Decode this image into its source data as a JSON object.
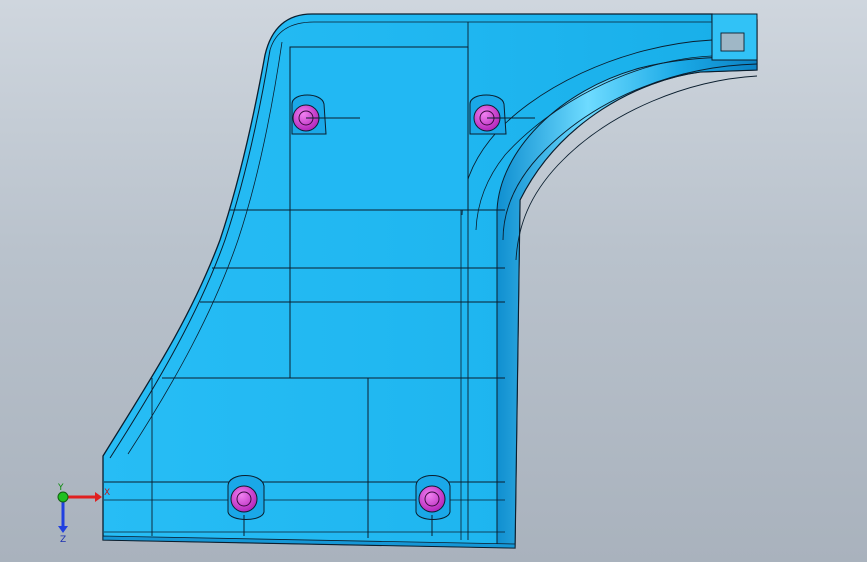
{
  "viewport": {
    "background_top": "#cfd6de",
    "background_bottom": "#a9b2bd"
  },
  "model": {
    "part_color": "#1fb8f2",
    "part_highlight": "#5fd6ff",
    "part_shadow": "#0f8fd0",
    "edge_color": "#0a1e2e",
    "fastener_color": "#d43bd6",
    "fastener_count": 4
  },
  "triad": {
    "x_label": "X",
    "y_label": "Y",
    "z_label": "Z",
    "x_color": "#e02020",
    "y_color": "#20c020",
    "z_color": "#2040e0"
  }
}
